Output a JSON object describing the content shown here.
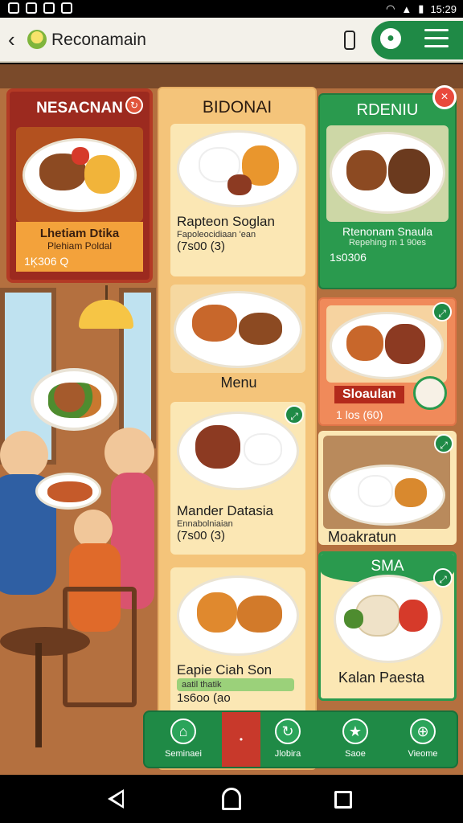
{
  "status_bar": {
    "time": "15:29"
  },
  "app_bar": {
    "title": "Reconamain"
  },
  "cards": {
    "left": {
      "title": "NESACNAN",
      "name": "Lhetiam Dtika",
      "subtitle": "Plehiam Poldal",
      "price": "1Ķ306 Q"
    },
    "middle": {
      "title": "BIDONAI",
      "menu_label": "Menu",
      "items": [
        {
          "name": "Rapteon Soglan",
          "subtitle": "Fapoleocidiaan 'ean",
          "price": "(7s00 (3)"
        },
        {
          "name": "Mander Datasia",
          "subtitle": "Ennabolniaian",
          "price": "(7s00 (3)"
        },
        {
          "name": "Eapie Ciah Son",
          "subtitle": "aatil thatik",
          "price": "1s6oo (ao"
        }
      ]
    },
    "right": {
      "title": "RDENIU",
      "name": "Rtenonam Snaula",
      "subtitle": "Repehing rn 1 90es",
      "price": "1s0306",
      "featured_label": "Sloaulan",
      "featured_price": "1 los (60)",
      "item_name": "Moakratun",
      "sma_title": "SMA",
      "sma_item": "Kalan Paesta"
    }
  },
  "bottom_nav": [
    {
      "label": "Seminaei",
      "icon": "home-icon",
      "glyph": "⌂"
    },
    {
      "label": "•",
      "icon": "dot-icon",
      "glyph": "•"
    },
    {
      "label": "Jlobira",
      "icon": "refresh-icon",
      "glyph": "↻"
    },
    {
      "label": "Saoe",
      "icon": "star-icon",
      "glyph": "★"
    },
    {
      "label": "Vieome",
      "icon": "compass-icon",
      "glyph": "⊕"
    }
  ],
  "colors": {
    "accent_green": "#1f8a46",
    "accent_red": "#c8392b",
    "accent_orange": "#f3a23b"
  }
}
